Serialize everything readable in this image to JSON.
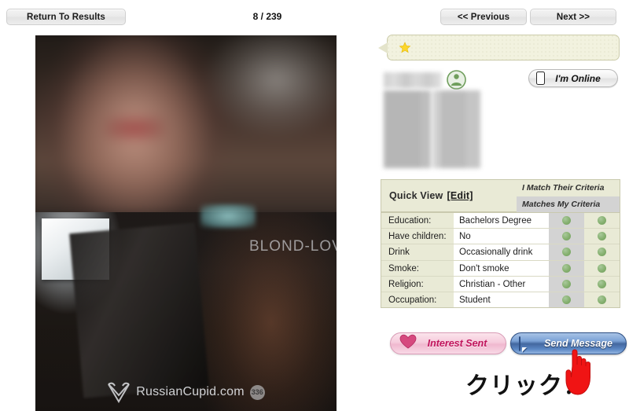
{
  "topbar": {
    "return_label": "Return To Results",
    "page_counter": "8 / 239",
    "prev_label": "<< Previous",
    "next_label": "Next >>"
  },
  "photo": {
    "watermark_overlay": "BLOND-LOV",
    "watermark_site": "RussianCupid.com",
    "watermark_badge": "336",
    "heart_icon": "heart-outline-icon"
  },
  "profile": {
    "bubble_star_icon": "star-icon",
    "bubble_text": "",
    "online_icon": "online-person-icon",
    "im_online_label": "I'm Online",
    "phone_icon": "mobile-phone-icon"
  },
  "quickview": {
    "title": "Quick View",
    "edit_label": "[Edit]",
    "header_col1": "I Match Their Criteria",
    "header_col2": "Matches My Criteria",
    "rows": [
      {
        "label": "Education:",
        "value": "Bachelors Degree",
        "match_theirs": true,
        "match_mine": true
      },
      {
        "label": "Have children:",
        "value": "No",
        "match_theirs": true,
        "match_mine": true
      },
      {
        "label": "Drink",
        "value": "Occasionally drink",
        "match_theirs": true,
        "match_mine": true
      },
      {
        "label": "Smoke:",
        "value": "Don't smoke",
        "match_theirs": true,
        "match_mine": true
      },
      {
        "label": "Religion:",
        "value": "Christian - Other",
        "match_theirs": true,
        "match_mine": true
      },
      {
        "label": "Occupation:",
        "value": "Student",
        "match_theirs": true,
        "match_mine": true
      }
    ]
  },
  "actions": {
    "interest_label": "Interest Sent",
    "interest_icon": "heart-icon",
    "send_label": "Send Message",
    "send_icon": "speech-bubble-icon"
  },
  "annotation": {
    "caption": "クリック！",
    "cursor_icon": "pointing-hand-cursor"
  },
  "colors": {
    "accent_blue": "#43679f",
    "accent_pink": "#c0135b",
    "match_green": "#85b06f",
    "panel_cream": "#e9ead6"
  }
}
